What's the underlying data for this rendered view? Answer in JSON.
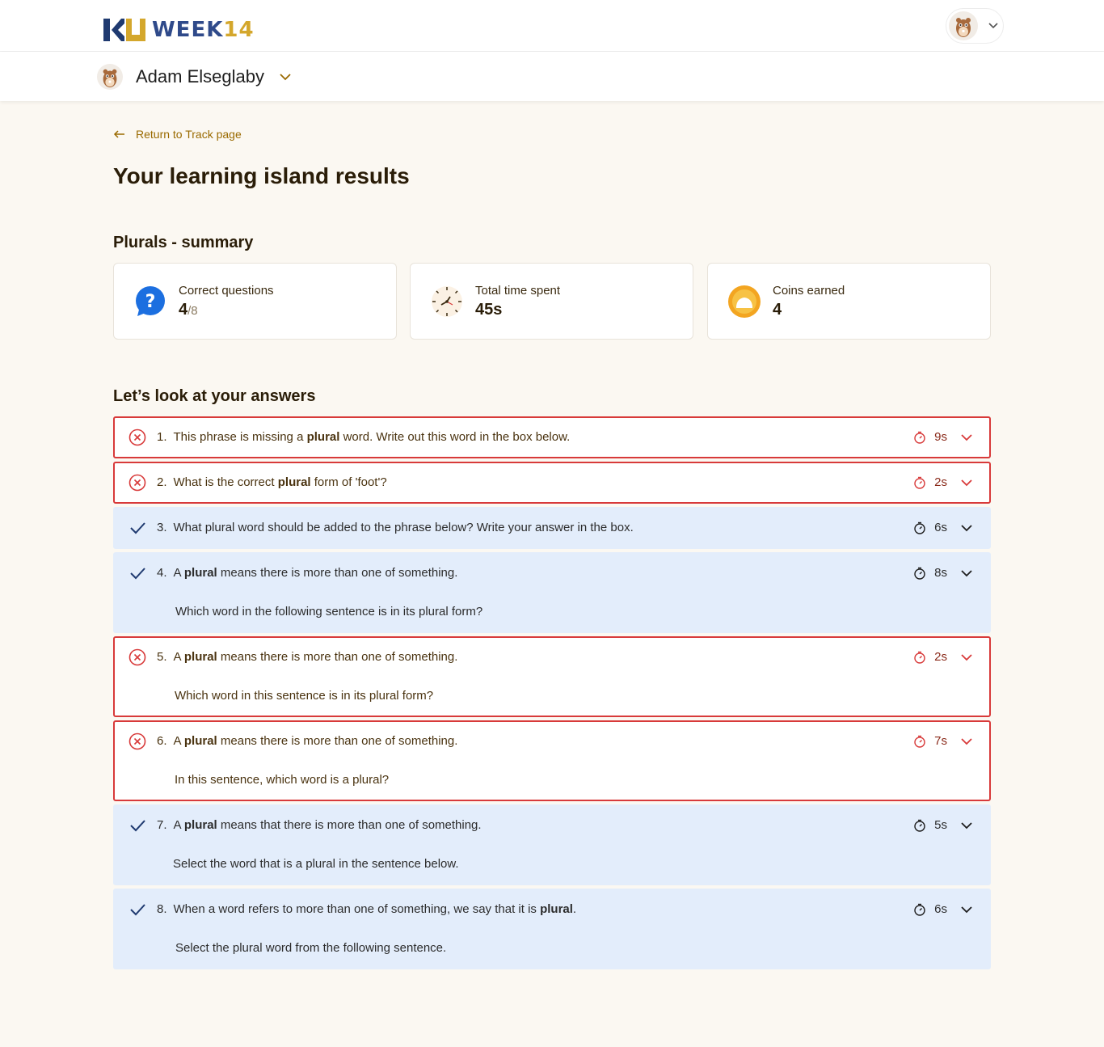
{
  "header": {
    "logo_text": "WEEK",
    "logo_num": "14"
  },
  "child": {
    "name": "Adam Elseglaby"
  },
  "nav": {
    "back_label": "Return to Track page"
  },
  "page": {
    "title": "Your learning island results",
    "summary_title": "Plurals - summary",
    "answers_title": "Let’s look at your answers"
  },
  "summary": {
    "correct": {
      "label": "Correct questions",
      "value": "4",
      "total": "/8",
      "icon": "question-icon"
    },
    "time": {
      "label": "Total time spent",
      "value": "45s",
      "icon": "clock-icon"
    },
    "coins": {
      "label": "Coins earned",
      "value": "4",
      "icon": "coin-icon"
    }
  },
  "colors": {
    "wrong": "#d83a3a",
    "correct_bg": "#e3edfb",
    "accent": "#9a6a00",
    "background": "#fbf8f2"
  },
  "questions": [
    {
      "num": "1.",
      "status": "wrong",
      "time": "9s",
      "pre": "This phrase is missing a ",
      "bold": "plural",
      "post": " word. Write out this word in the box below.",
      "line2": ""
    },
    {
      "num": "2.",
      "status": "wrong",
      "time": "2s",
      "pre": "What is the correct ",
      "bold": "plural",
      "post": " form of 'foot'?",
      "line2": ""
    },
    {
      "num": "3.",
      "status": "correct",
      "time": "6s",
      "pre": "What plural word should be added to the phrase below? Write your answer in the box.",
      "bold": "",
      "post": "",
      "line2": ""
    },
    {
      "num": "4.",
      "status": "correct",
      "time": "8s",
      "pre": "A ",
      "bold": "plural",
      "post": " means there is more than one of something.",
      "line2": "Which word in the following sentence is in its plural form?"
    },
    {
      "num": "5.",
      "status": "wrong",
      "time": "2s",
      "pre": "A ",
      "bold": "plural",
      "post": " means there is more than one of something.",
      "line2": "Which word in this sentence is in its plural form?"
    },
    {
      "num": "6.",
      "status": "wrong",
      "time": "7s",
      "pre": "A ",
      "bold": "plural",
      "post": " means there is more than one of something.",
      "line2": "In this sentence, which word is a plural?"
    },
    {
      "num": "7.",
      "status": "correct",
      "time": "5s",
      "pre": "A ",
      "bold": "plural",
      "post": " means that there is more than one of something.",
      "line2": "Select the word that is a plural in the sentence below."
    },
    {
      "num": "8.",
      "status": "correct",
      "time": "6s",
      "pre": "When a word refers to more than one of something, we say that it is ",
      "bold": "plural",
      "post": ".",
      "line2": "Select the plural word from the following sentence."
    }
  ]
}
